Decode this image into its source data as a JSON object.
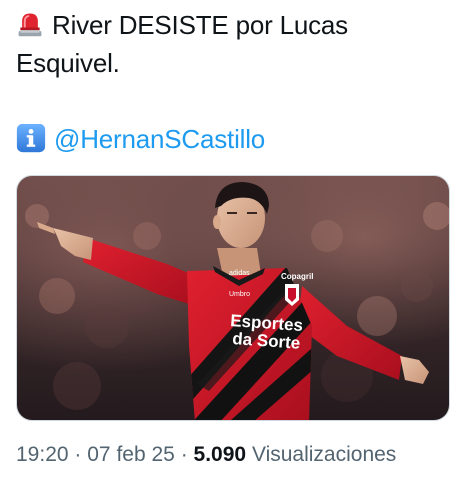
{
  "tweet": {
    "line1": "River DESISTE por Lucas",
    "line2": "Esquivel.",
    "mention": "@HernanSCastillo",
    "icons": {
      "lead": "rotating-light-siren-icon",
      "mention_prefix": "information-icon"
    },
    "media": {
      "jersey_sponsor_line1": "Esportes",
      "jersey_sponsor_line2": "da Sorte",
      "jersey_brand": "Umbro",
      "jersey_chest_sponsor": "Copagril",
      "jersey_colors": [
        "#d4142a",
        "#111111"
      ]
    },
    "meta": {
      "time": "19:20",
      "separator": "·",
      "date": "07 feb 25",
      "views_count": "5.090",
      "views_label": "Visualizaciones"
    }
  },
  "colors": {
    "link": "#1d9bf0",
    "text": "#0f1419",
    "secondary": "#536471",
    "border": "#cfd9de"
  }
}
